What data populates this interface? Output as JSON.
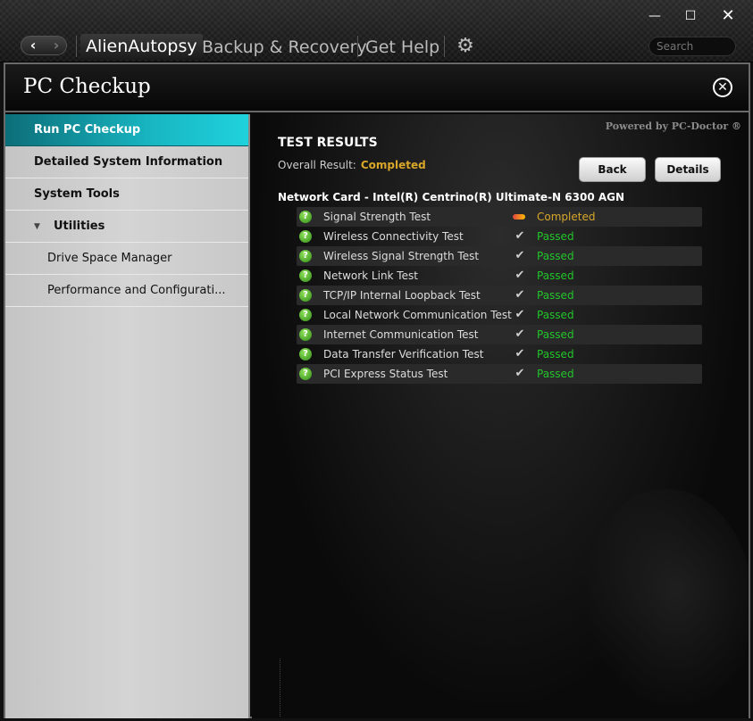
{
  "window": {
    "minimize": "—",
    "maximize": "☐",
    "close": "✕"
  },
  "nav": {
    "back": "‹",
    "forward": "›"
  },
  "header": {
    "brand": "AlienAutopsy",
    "backup": "Backup & Recovery",
    "help": "Get Help",
    "search_placeholder": "Search"
  },
  "page": {
    "title": "PC Checkup",
    "close": "✕"
  },
  "sidebar": {
    "items": [
      {
        "label": "Run PC Checkup"
      },
      {
        "label": "Detailed System Information"
      },
      {
        "label": "System Tools"
      },
      {
        "label": "Utilities"
      },
      {
        "label": "Drive Space Manager"
      },
      {
        "label": "Performance and Configurati..."
      }
    ]
  },
  "main": {
    "powered_by": "Powered by PC-Doctor ®",
    "results_title": "TEST RESULTS",
    "overall_label": "Overall Result:",
    "overall_value": "Completed",
    "back_button": "Back",
    "details_button": "Details",
    "device": "Network Card - Intel(R) Centrino(R) Ultimate-N 6300 AGN",
    "tests": [
      {
        "name": "Signal Strength Test",
        "status": "Completed"
      },
      {
        "name": "Wireless Connectivity Test",
        "status": "Passed"
      },
      {
        "name": "Wireless Signal Strength Test",
        "status": "Passed"
      },
      {
        "name": "Network Link Test",
        "status": "Passed"
      },
      {
        "name": "TCP/IP Internal Loopback Test",
        "status": "Passed"
      },
      {
        "name": "Local Network Communication Test",
        "status": "Passed"
      },
      {
        "name": "Internet Communication Test",
        "status": "Passed"
      },
      {
        "name": "Data Transfer Verification Test",
        "status": "Passed"
      },
      {
        "name": "PCI Express Status Test",
        "status": "Passed"
      }
    ]
  },
  "colors": {
    "accent": "#18b6c2",
    "passed": "#22c62a",
    "completed": "#d8a72a"
  }
}
